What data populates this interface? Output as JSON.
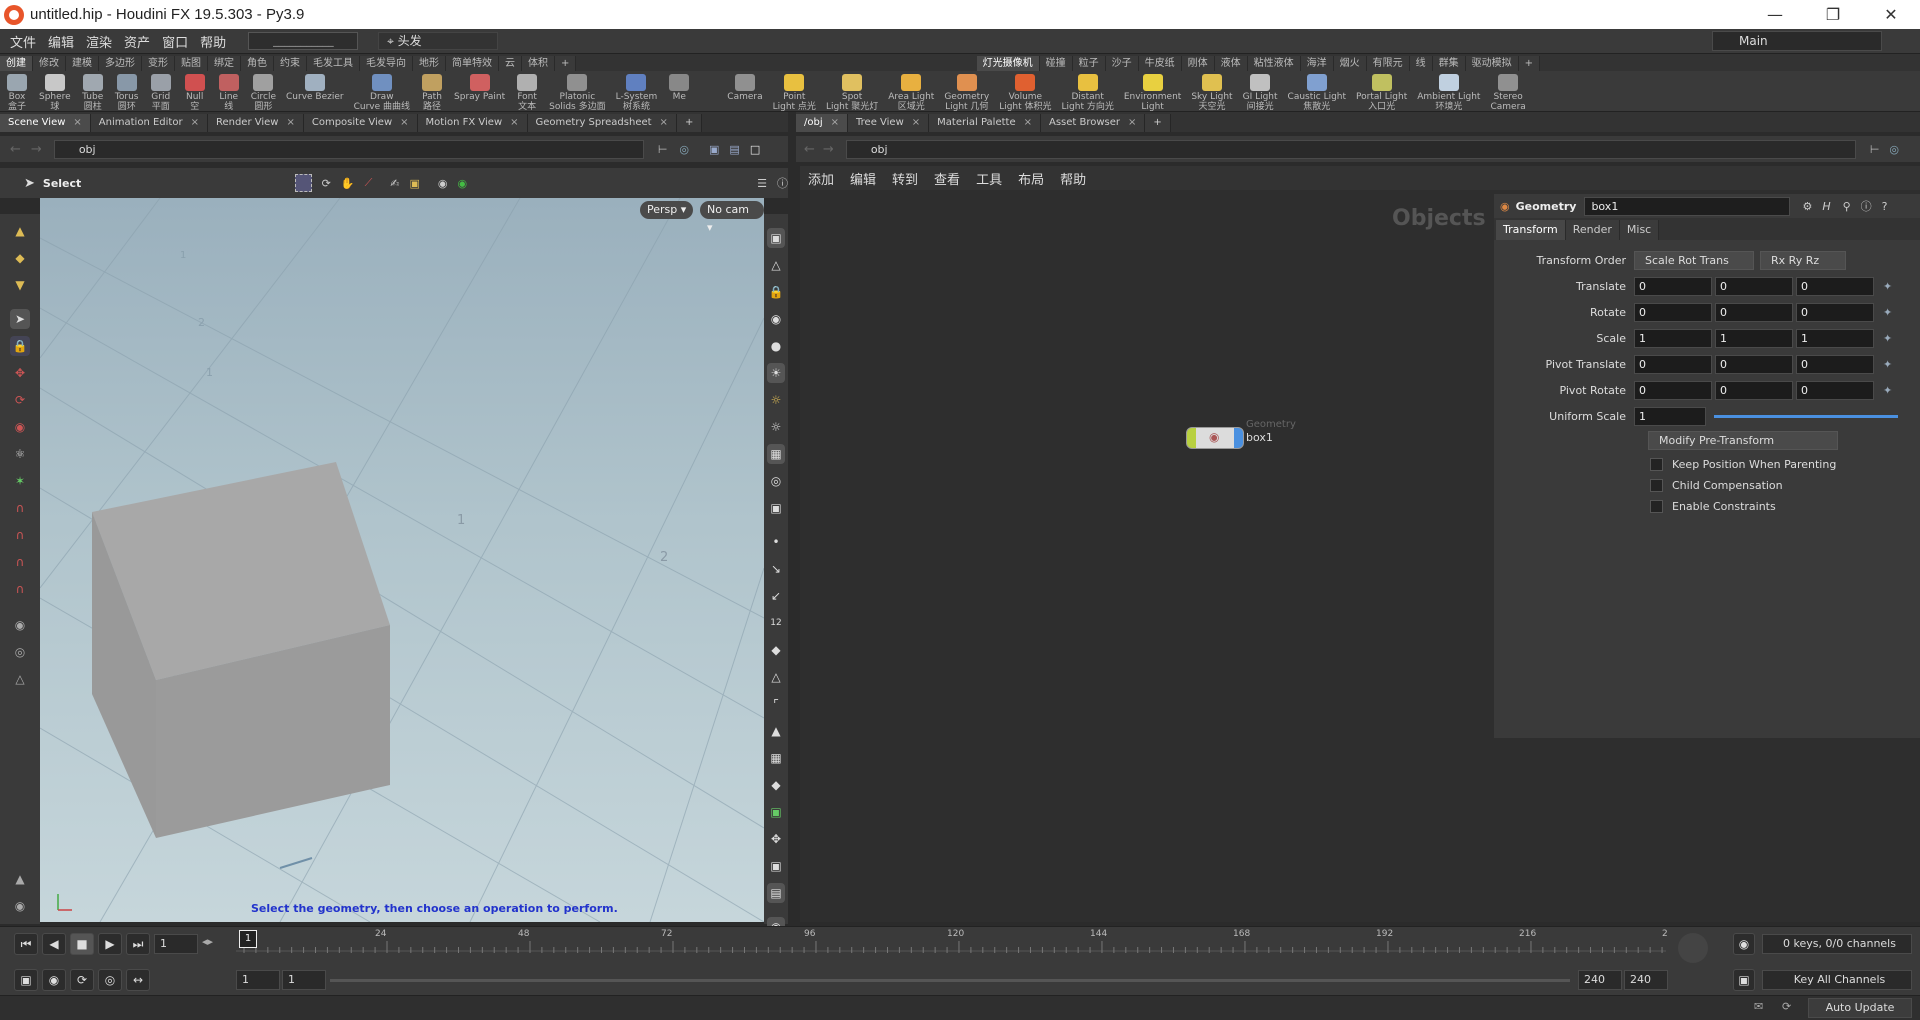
{
  "title": "untitled.hip - Houdini FX 19.5.303 - Py3.9",
  "menu": [
    "文件",
    "编辑",
    "渲染",
    "资产",
    "窗口",
    "帮助"
  ],
  "desktop_combo": "___________",
  "head_label": "头发",
  "desktop_main": "Main",
  "left_shelf_tabs": [
    "创建",
    "修改",
    "建模",
    "多边形",
    "变形",
    "贴图",
    "绑定",
    "角色",
    "约束",
    "毛发工具",
    "毛发导向",
    "地形",
    "简单特效",
    "云",
    "体积"
  ],
  "right_shelf_tabs": [
    "灯光摄像机",
    "碰撞",
    "粒子",
    "沙子",
    "牛皮纸",
    "刚体",
    "液体",
    "粘性液体",
    "海洋",
    "烟火",
    "有限元",
    "线",
    "群集",
    "驱动模拟"
  ],
  "left_tools": [
    {
      "l1": "Box",
      "l2": "盒子",
      "c": "#9aa6b0"
    },
    {
      "l1": "Sphere",
      "l2": "球",
      "c": "#c8c8c8"
    },
    {
      "l1": "Tube",
      "l2": "圆柱",
      "c": "#a0a8b0"
    },
    {
      "l1": "Torus",
      "l2": "圆环",
      "c": "#8898a8"
    },
    {
      "l1": "Grid",
      "l2": "平面",
      "c": "#9aa0a8"
    },
    {
      "l1": "Null",
      "l2": "空",
      "c": "#d05050"
    },
    {
      "l1": "Line",
      "l2": "线",
      "c": "#c06060"
    },
    {
      "l1": "Circle",
      "l2": "圆形",
      "c": "#a0a0a0"
    },
    {
      "l1": "Curve Bezier",
      "l2": "",
      "c": "#a0b0c0"
    },
    {
      "l1": "Draw",
      "l2": "Curve 曲曲线",
      "c": "#7090c0"
    },
    {
      "l1": "Path",
      "l2": "路径",
      "c": "#c0a060"
    },
    {
      "l1": "Spray Paint",
      "l2": "",
      "c": "#d06060"
    },
    {
      "l1": "Font",
      "l2": "文本",
      "c": "#b0b0b0"
    },
    {
      "l1": "Platonic",
      "l2": "Solids 多边面",
      "c": "#909090"
    },
    {
      "l1": "L-System",
      "l2": "树系统",
      "c": "#6080c0"
    },
    {
      "l1": "Me",
      "l2": "",
      "c": "#888"
    }
  ],
  "right_tools": [
    {
      "l1": "Camera",
      "l2": "",
      "c": "#909090"
    },
    {
      "l1": "Point",
      "l2": "Light 点光",
      "c": "#e8c040"
    },
    {
      "l1": "Spot",
      "l2": "Light 聚光灯",
      "c": "#e0c060"
    },
    {
      "l1": "Area Light",
      "l2": "区域光",
      "c": "#e8b040"
    },
    {
      "l1": "Geometry",
      "l2": "Light 几何",
      "c": "#e09050"
    },
    {
      "l1": "Volume",
      "l2": "Light 体积光",
      "c": "#e06030"
    },
    {
      "l1": "Distant",
      "l2": "Light 方向光",
      "c": "#e8c040"
    },
    {
      "l1": "Environment",
      "l2": "Light",
      "c": "#e8d040"
    },
    {
      "l1": "Sky Light",
      "l2": "天空光",
      "c": "#e0c050"
    },
    {
      "l1": "GI Light",
      "l2": "间接光",
      "c": "#c0c0c0"
    },
    {
      "l1": "Caustic Light",
      "l2": "焦散光",
      "c": "#80a0d0"
    },
    {
      "l1": "Portal Light",
      "l2": "入口光",
      "c": "#c0c060"
    },
    {
      "l1": "Ambient Light",
      "l2": "环境光",
      "c": "#c0d0e0"
    },
    {
      "l1": "Stereo",
      "l2": "Camera",
      "c": "#909090"
    }
  ],
  "left_panes": [
    "Scene View",
    "Animation Editor",
    "Render View",
    "Composite View",
    "Motion FX View",
    "Geometry Spreadsheet"
  ],
  "right_panes": [
    "/obj",
    "Tree View",
    "Material Palette",
    "Asset Browser"
  ],
  "left_path": "obj",
  "right_path": "obj",
  "select_label": "Select",
  "viewport": {
    "persp": "Persp ▾",
    "cam": "No cam ▾",
    "hint": "Select the geometry, then choose an operation to perform.",
    "grid_labels": [
      "1",
      "2",
      "1",
      "2",
      "1"
    ]
  },
  "network": {
    "menu": [
      "添加",
      "编辑",
      "转到",
      "查看",
      "工具",
      "布局",
      "帮助"
    ],
    "context": "Objects",
    "node_type": "Geometry",
    "node_name": "box1"
  },
  "params": {
    "type": "Geometry",
    "name": "box1",
    "tabs": [
      "Transform",
      "Render",
      "Misc"
    ],
    "transform_order_label": "Transform Order",
    "transform_order": "Scale Rot Trans",
    "rot_order": "Rx Ry Rz",
    "rows": [
      {
        "label": "Translate",
        "values": [
          "0",
          "0",
          "0"
        ]
      },
      {
        "label": "Rotate",
        "values": [
          "0",
          "0",
          "0"
        ]
      },
      {
        "label": "Scale",
        "values": [
          "1",
          "1",
          "1"
        ]
      },
      {
        "label": "Pivot Translate",
        "values": [
          "0",
          "0",
          "0"
        ]
      },
      {
        "label": "Pivot Rotate",
        "values": [
          "0",
          "0",
          "0"
        ]
      }
    ],
    "uniform_scale_label": "Uniform Scale",
    "uniform_scale": "1",
    "pre_transform": "Modify Pre-Transform",
    "checks": [
      "Keep Position When Parenting",
      "Child Compensation",
      "Enable Constraints"
    ]
  },
  "timeline": {
    "frame": "1",
    "ticks": [
      "24",
      "48",
      "72",
      "96",
      "120",
      "144",
      "168",
      "192",
      "216",
      "2"
    ],
    "start1": "1",
    "start2": "1",
    "end1": "240",
    "end2": "240",
    "keys": "0 keys, 0/0 channels",
    "key_all": "Key All Channels",
    "auto_update": "Auto Update",
    "cursor_frame": "1"
  }
}
